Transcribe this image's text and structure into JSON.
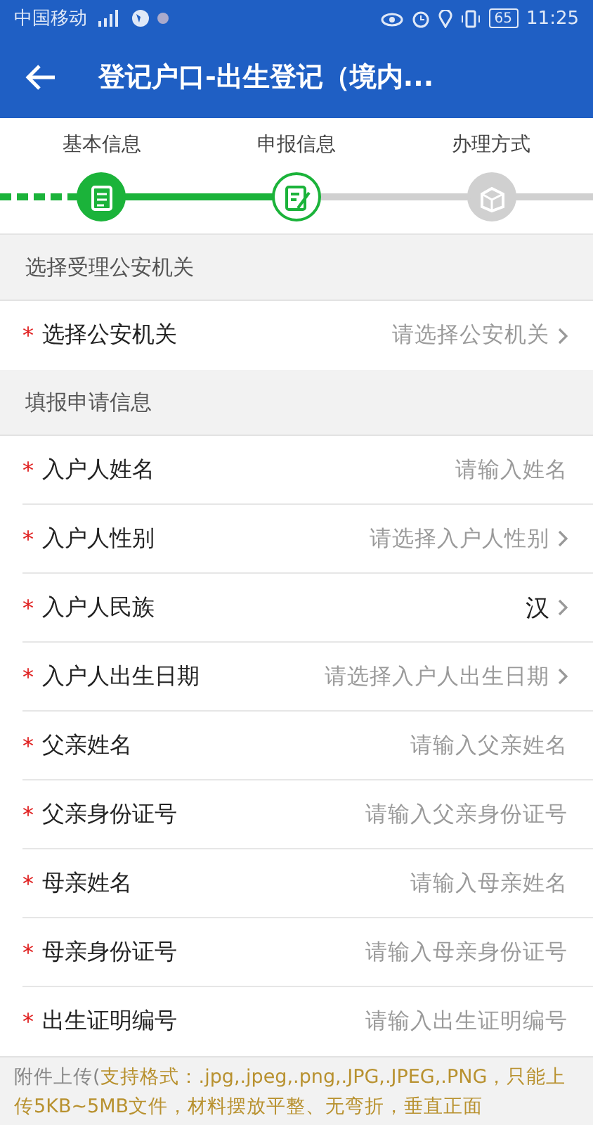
{
  "status_bar": {
    "carrier": "中国移动",
    "battery": "65",
    "time": "11:25"
  },
  "header": {
    "title": "登记户口-出生登记（境内..."
  },
  "steps": [
    {
      "label": "基本信息",
      "completed": true,
      "selected": false
    },
    {
      "label": "申报信息",
      "completed": false,
      "selected": true
    },
    {
      "label": "办理方式",
      "completed": false,
      "selected": false
    }
  ],
  "sections": [
    {
      "title": "选择受理公安机关",
      "rows": [
        {
          "label": "选择公安机关",
          "required_mark": "*",
          "kind": "select",
          "placeholder": "请选择公安机关"
        }
      ]
    },
    {
      "title": "填报申请信息",
      "rows": [
        {
          "label": "入户人姓名",
          "required_mark": "*",
          "kind": "input",
          "placeholder": "请输入姓名"
        },
        {
          "label": "入户人性别",
          "required_mark": "*",
          "kind": "select",
          "placeholder": "请选择入户人性别"
        },
        {
          "label": "入户人民族",
          "required_mark": "*",
          "kind": "select",
          "value": "汉"
        },
        {
          "label": "入户人出生日期",
          "required_mark": "*",
          "kind": "select",
          "placeholder": "请选择入户人出生日期"
        },
        {
          "label": "父亲姓名",
          "required_mark": "*",
          "kind": "input",
          "placeholder": "请输入父亲姓名"
        },
        {
          "label": "父亲身份证号",
          "required_mark": "*",
          "kind": "input",
          "placeholder": "请输入父亲身份证号"
        },
        {
          "label": "母亲姓名",
          "required_mark": "*",
          "kind": "input",
          "placeholder": "请输入母亲姓名"
        },
        {
          "label": "母亲身份证号",
          "required_mark": "*",
          "kind": "input",
          "placeholder": "请输入母亲身份证号"
        },
        {
          "label": "出生证明编号",
          "required_mark": "*",
          "kind": "input",
          "placeholder": "请输入出生证明编号"
        }
      ]
    }
  ],
  "attachment": {
    "label": "附件上传(",
    "note": "支持格式：.jpg,.jpeg,.png,.JPG,.JPEG,.PNG，只能上传5KB~5MB文件，材料摆放平整、无弯折，垂直正面"
  }
}
